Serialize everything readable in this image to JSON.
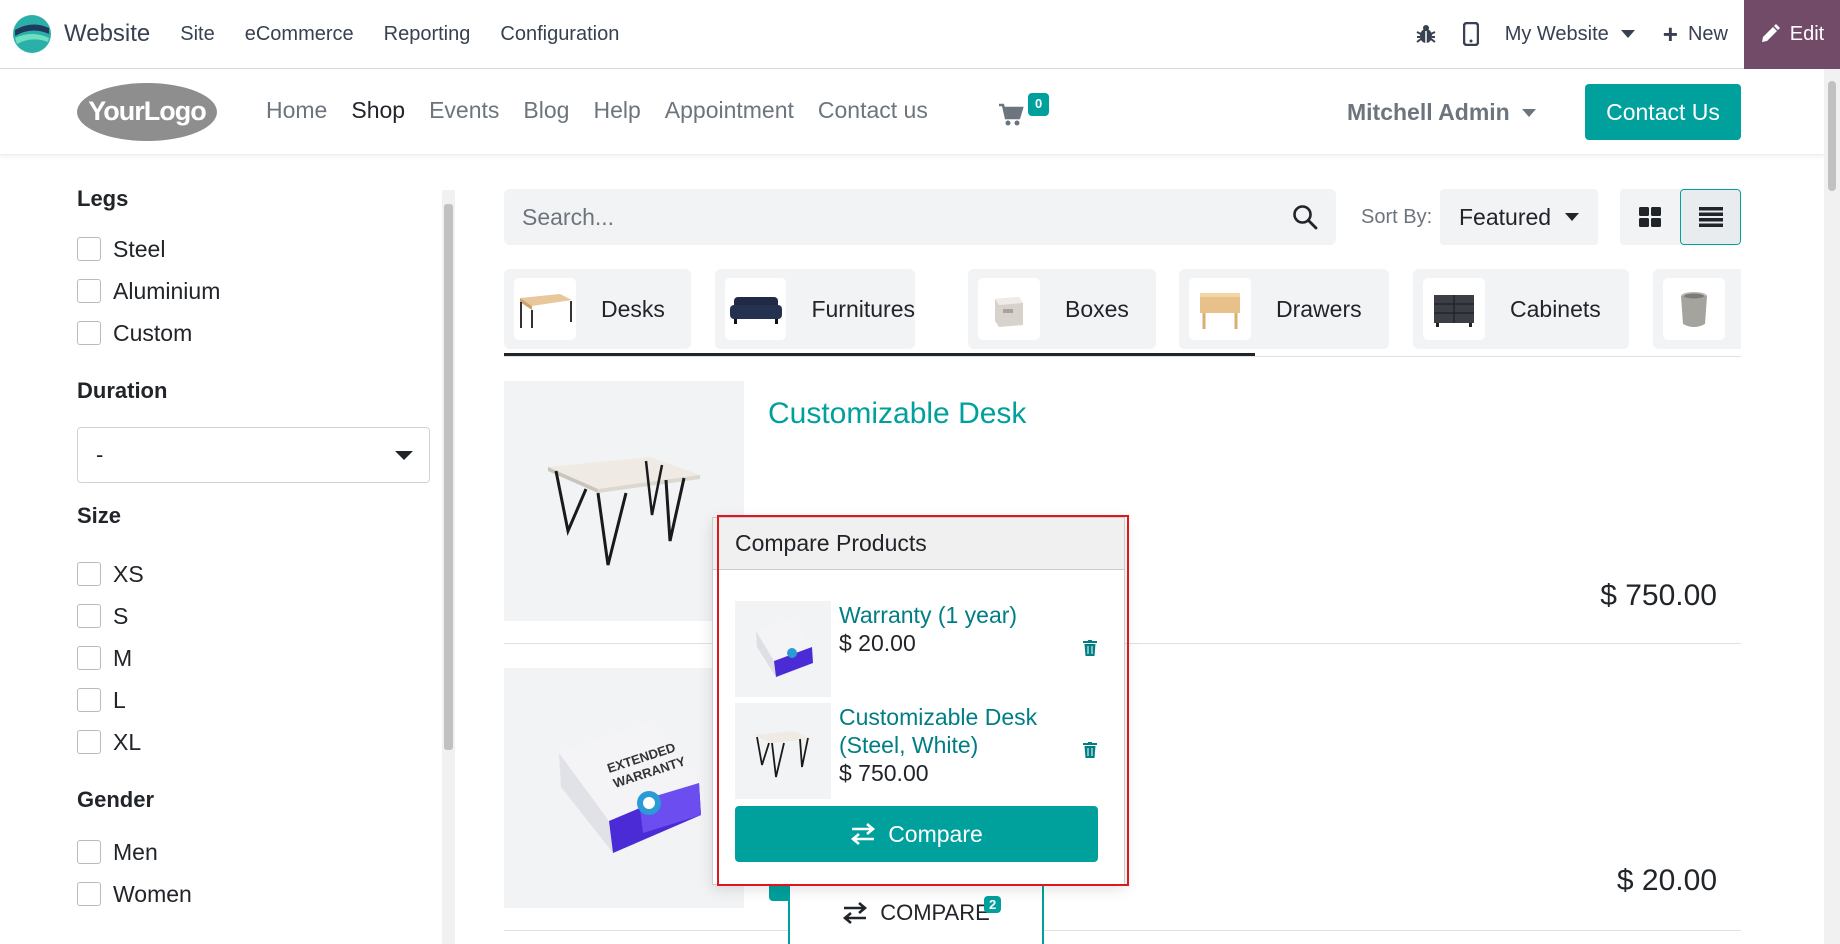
{
  "topbar": {
    "app_title": "Website",
    "menu": [
      "Site",
      "eCommerce",
      "Reporting",
      "Configuration"
    ],
    "website_selector": "My Website",
    "new_label": "New",
    "edit_label": "Edit",
    "accent": "#714b67"
  },
  "header": {
    "logo_text": "YourLogo",
    "nav": [
      "Home",
      "Shop",
      "Events",
      "Blog",
      "Help",
      "Appointment",
      "Contact us"
    ],
    "active_nav": "Shop",
    "cart_count": "0",
    "user": "Mitchell Admin",
    "contact_button": "Contact Us",
    "brand_color": "#00a09d"
  },
  "sidebar": {
    "groups": [
      {
        "title": "Legs",
        "options": [
          "Steel",
          "Aluminium",
          "Custom"
        ]
      },
      {
        "title": "Duration",
        "select_value": "-"
      },
      {
        "title": "Size",
        "options": [
          "XS",
          "S",
          "M",
          "L",
          "XL"
        ]
      },
      {
        "title": "Gender",
        "options": [
          "Men",
          "Women"
        ]
      }
    ]
  },
  "shop": {
    "search_placeholder": "Search...",
    "sort_label": "Sort By:",
    "sort_value": "Featured",
    "categories": [
      "Desks",
      "Furnitures",
      "Boxes",
      "Drawers",
      "Cabinets"
    ],
    "products": [
      {
        "name": "Customizable Desk",
        "price": "$ 750.00"
      },
      {
        "name": "Warranty",
        "price": "$ 20.00"
      }
    ],
    "compare_fab_label": "COMPARE",
    "compare_count": "2"
  },
  "compare_popover": {
    "title": "Compare Products",
    "items": [
      {
        "name": "Warranty (1 year)",
        "price": "$ 20.00"
      },
      {
        "name_line1": "Customizable Desk",
        "name_line2": "(Steel, White)",
        "price": "$ 750.00"
      }
    ],
    "button": "Compare"
  }
}
